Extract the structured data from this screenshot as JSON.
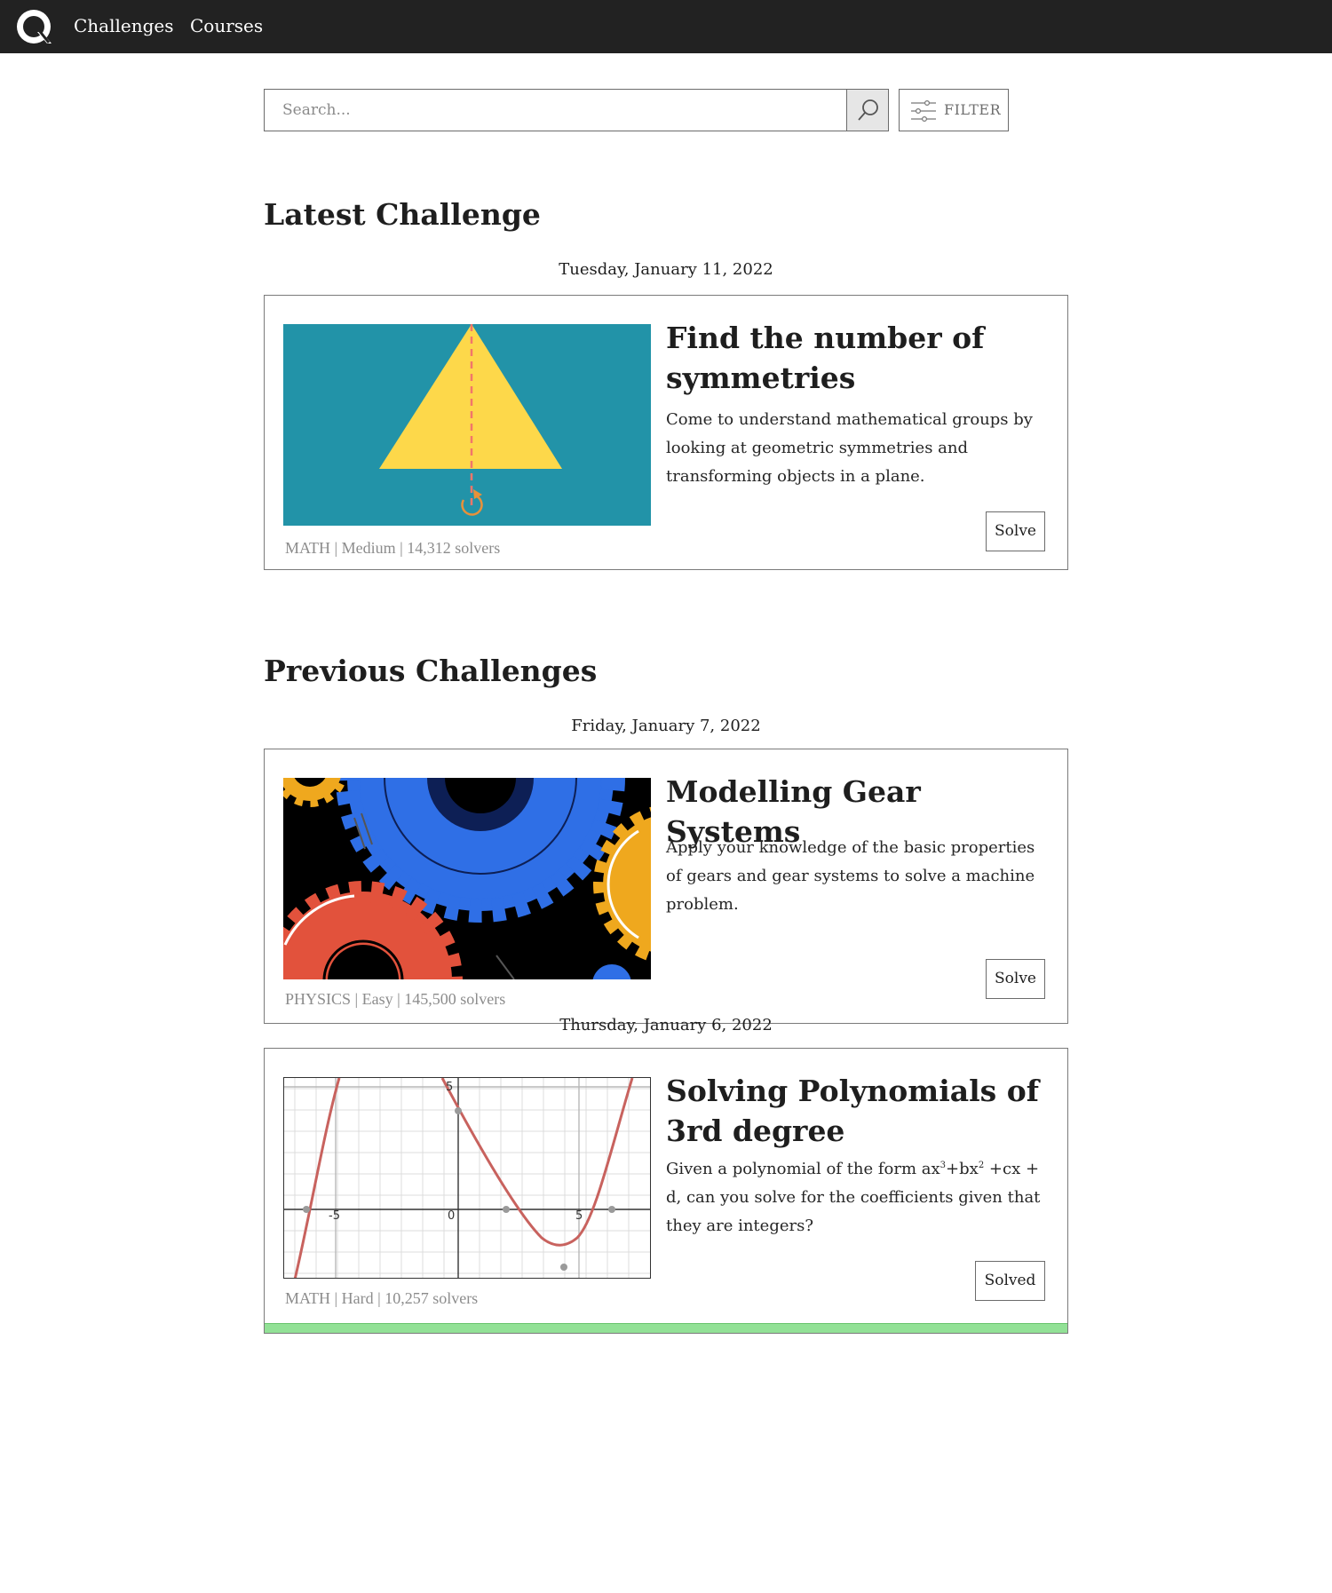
{
  "nav": {
    "logo": "Q",
    "links": [
      "Challenges",
      "Courses"
    ]
  },
  "search": {
    "placeholder": "Search...",
    "filter_label": "FILTER"
  },
  "latest": {
    "heading": "Latest Challenge",
    "date": "Tuesday, January 11, 2022",
    "card": {
      "title": "Find the number of symmetries",
      "description": "Come to understand mathematical groups by looking at geometric symmetries and transforming objects in a plane.",
      "meta": "MATH | Medium | 14,312 solvers",
      "button": "Solve"
    }
  },
  "previous": {
    "heading": "Previous Challenges",
    "items": [
      {
        "date": "Friday, January 7, 2022",
        "title": "Modelling Gear Systems",
        "description": "Apply your knowledge of the basic properties of gears and gear systems to solve a machine problem.",
        "meta": "PHYSICS | Easy | 145,500 solvers",
        "button": "Solve"
      },
      {
        "date": "Thursday, January 6, 2022",
        "title": "Solving Polynomials of 3rd degree",
        "desc_parts": [
          "Given a polynomial of the form ax",
          "3",
          "+bx",
          "2",
          " +cx + d, can you solve for the coefficients given that they are integers?"
        ],
        "meta": "MATH | Hard | 10,257 solvers",
        "button": "Solved",
        "graph_labels": [
          "-5",
          "0",
          "5",
          "5"
        ]
      }
    ]
  },
  "colors": {
    "topbar": "#222222",
    "solved_bar": "#92e196",
    "teal": "#2293a8",
    "triangle": "#fdd84a"
  }
}
